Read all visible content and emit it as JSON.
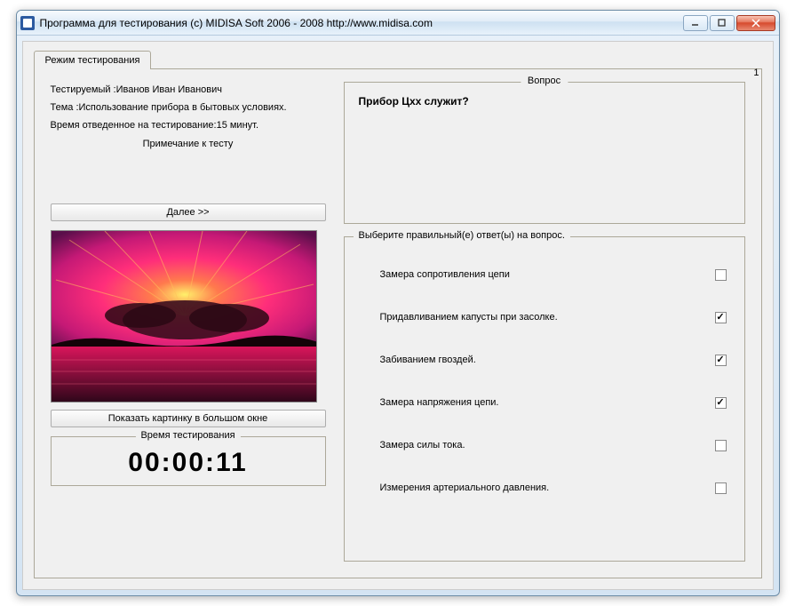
{
  "window": {
    "title": "Программа для тестирования (c) MIDISA Soft 2006 - 2008 http://www.midisa.com"
  },
  "tab": {
    "label": "Режим тестирования"
  },
  "info": {
    "testee_label": "Тестируемый :   ",
    "testee_value": "Иванов Иван Иванович",
    "topic_label": "Тема :   ",
    "topic_value": "Использование прибора в бытовых условиях.",
    "time_label": "Время отведенное на тестирование: ",
    "time_value": "15 минут.",
    "note": "Примечание к тесту",
    "question_number": "1"
  },
  "buttons": {
    "next": "Далее >>",
    "show_picture": "Показать картинку в большом окне"
  },
  "timer": {
    "label": "Время тестирования",
    "value": "00:00:11"
  },
  "question": {
    "box_label": "Вопрос",
    "text": "Прибор Цхх служит?"
  },
  "answers": {
    "box_label": "Выберите правильный(е) ответ(ы) на вопрос.",
    "items": [
      {
        "text": "Замера сопротивления цепи",
        "checked": false
      },
      {
        "text": "Придавливанием капусты при засолке.",
        "checked": true
      },
      {
        "text": "Забиванием гвоздей.",
        "checked": true
      },
      {
        "text": "Замера напряжения цепи.",
        "checked": true
      },
      {
        "text": "Замера силы тока.",
        "checked": false
      },
      {
        "text": "Измерения артериального давления.",
        "checked": false
      }
    ]
  }
}
